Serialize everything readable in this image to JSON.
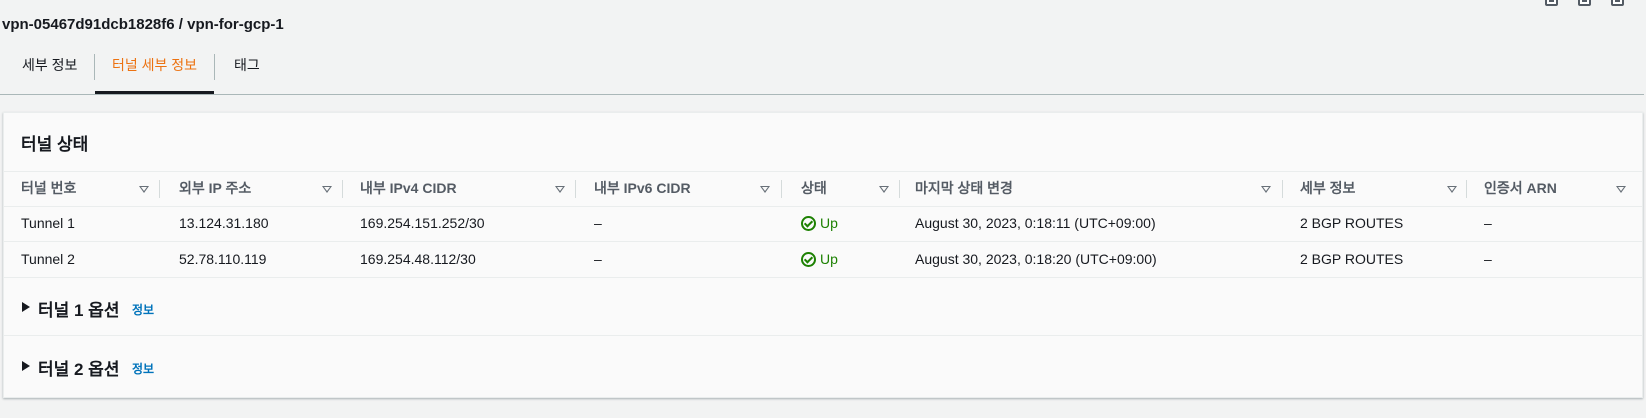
{
  "header": {
    "title": "vpn-05467d91dcb1828f6 / vpn-for-gcp-1"
  },
  "tabs": [
    {
      "label": "세부 정보"
    },
    {
      "label": "터널 세부 정보"
    },
    {
      "label": "태그"
    }
  ],
  "panel": {
    "title": "터널 상태",
    "columns": [
      "터널 번호",
      "외부 IP 주소",
      "내부 IPv4 CIDR",
      "내부 IPv6 CIDR",
      "상태",
      "마지막 상태 변경",
      "세부 정보",
      "인증서 ARN"
    ],
    "rows": [
      {
        "tunnel": "Tunnel 1",
        "outside_ip": "13.124.31.180",
        "ipv4_cidr": "169.254.151.252/30",
        "ipv6_cidr": "–",
        "status": "Up",
        "last_change": "August 30, 2023, 0:18:11 (UTC+09:00)",
        "details": "2 BGP ROUTES",
        "cert_arn": "–"
      },
      {
        "tunnel": "Tunnel 2",
        "outside_ip": "52.78.110.119",
        "ipv4_cidr": "169.254.48.112/30",
        "ipv6_cidr": "–",
        "status": "Up",
        "last_change": "August 30, 2023, 0:18:20 (UTC+09:00)",
        "details": "2 BGP ROUTES",
        "cert_arn": "–"
      }
    ],
    "options": [
      {
        "title": "터널 1 옵션",
        "info": "정보"
      },
      {
        "title": "터널 2 옵션",
        "info": "정보"
      }
    ]
  },
  "colors": {
    "accent": "#ec7211",
    "success": "#1d8102",
    "link": "#0073bb"
  }
}
